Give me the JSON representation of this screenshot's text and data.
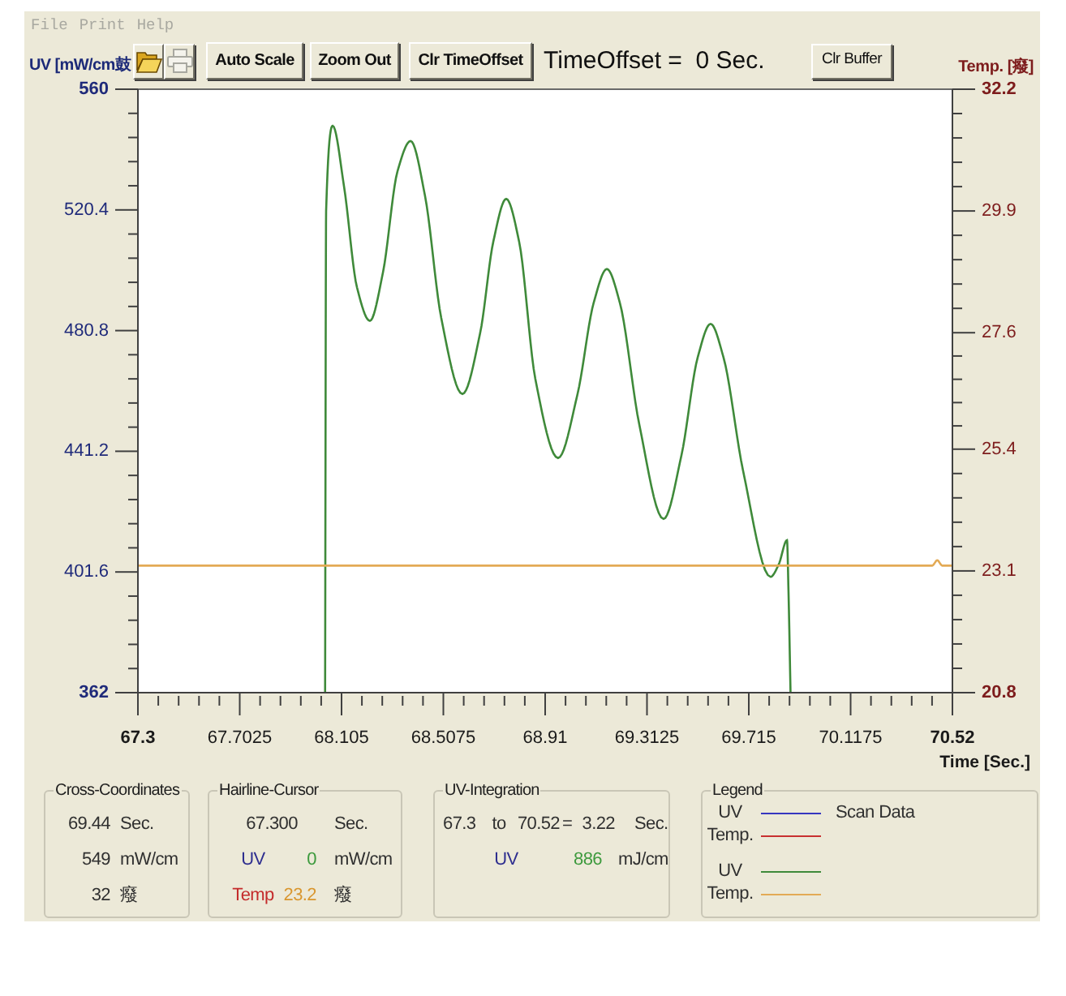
{
  "menu": [
    {
      "label": "File",
      "disabled": true
    },
    {
      "label": "Print",
      "disabled": true
    },
    {
      "label": "Help",
      "disabled": true
    }
  ],
  "toolbar": {
    "icon_buttons": [
      {
        "kind": "folder",
        "disabled": false
      },
      {
        "kind": "printer",
        "disabled": true
      }
    ],
    "buttons": [
      "Auto Scale",
      "Zoom Out",
      "Clr TimeOffset"
    ],
    "offset_text": "TimeOffset =  0 Sec.",
    "clear_button": "Clr Buffer"
  },
  "chart": {
    "chart_data": {
      "type": "line",
      "xlabel": "Time [Sec.]",
      "ylabel": "UV [mW/cm鼓",
      "y2label": "Temp. [癈]",
      "x": [
        67.3,
        68.04,
        68.044,
        68.07,
        68.115,
        68.166,
        68.217,
        68.269,
        68.326,
        68.378,
        68.435,
        68.499,
        68.583,
        68.653,
        68.705,
        68.756,
        68.807,
        68.871,
        68.961,
        69.038,
        69.102,
        69.154,
        69.205,
        69.282,
        69.378,
        69.449,
        69.513,
        69.564,
        69.615,
        69.692,
        69.801,
        69.833,
        69.866,
        69.872,
        69.88,
        70.44,
        70.46,
        70.48,
        70.52
      ],
      "series": [
        {
          "name": "UV",
          "color": "#3f8a3a",
          "values": [
            null,
            362,
            520,
            548,
            528,
            495,
            484,
            500,
            533,
            543,
            525,
            485,
            460,
            480,
            510,
            524,
            510,
            465,
            439,
            460,
            490,
            501,
            490,
            450,
            419,
            440,
            472,
            483,
            472,
            435,
            400,
            404,
            412,
            395,
            362,
            null,
            null,
            null,
            null
          ]
        },
        {
          "name": "Temp.",
          "color": "#e3aa55",
          "axis": "y2",
          "values": [
            23.2,
            23.2,
            23.2,
            23.2,
            23.2,
            23.2,
            23.2,
            23.2,
            23.2,
            23.2,
            23.2,
            23.2,
            23.2,
            23.2,
            23.2,
            23.2,
            23.2,
            23.2,
            23.2,
            23.2,
            23.2,
            23.2,
            23.2,
            23.2,
            23.2,
            23.2,
            23.2,
            23.2,
            23.2,
            23.2,
            23.2,
            23.2,
            23.2,
            23.2,
            23.2,
            23.2,
            23.3,
            23.2,
            23.2
          ]
        }
      ],
      "xlim": [
        67.3,
        70.52
      ],
      "ylim": [
        362,
        560
      ],
      "y2lim": [
        20.8,
        32.2
      ],
      "xticks": [
        67.3,
        67.7025,
        68.105,
        68.5075,
        68.91,
        69.3125,
        69.715,
        70.1175,
        70.52
      ],
      "yticks": [
        560,
        520.4,
        480.8,
        441.2,
        401.6,
        362
      ],
      "y2ticks": [
        32.2,
        29.9,
        27.6,
        25.4,
        23.1,
        20.8
      ]
    }
  },
  "panels": [
    {
      "kind": "readout",
      "title": "Cross-Coordinates",
      "rows": [
        {
          "value": "69.44",
          "unit": "Sec."
        },
        {
          "value": "549",
          "unit": "mW/cm"
        },
        {
          "value": "32",
          "unit": "癈"
        }
      ]
    },
    {
      "kind": "cursor",
      "title": "Hairline-Cursor",
      "rows": [
        {
          "value": {
            "text": "67.300"
          },
          "unit": "Sec."
        },
        {
          "label": {
            "text": "UV",
            "color": "#2e2e8f"
          },
          "value": {
            "text": "0",
            "color": "#3d9a3d"
          },
          "unit": "mW/cm"
        },
        {
          "label": {
            "text": "Temp",
            "color": "#c42b2b"
          },
          "value": {
            "text": "23.2",
            "color": "#d9962e"
          },
          "unit": "癈"
        }
      ]
    },
    {
      "kind": "integration",
      "title": "UV-Integration",
      "rows": [
        {
          "kind": "range",
          "from": "67.3",
          "joiner": "to",
          "to": "70.52",
          "equals": "=",
          "value": "3.22",
          "unit": "Sec."
        },
        {
          "kind": "reading",
          "label": {
            "text": "UV",
            "color": "#2e2e8f"
          },
          "value": {
            "text": "886",
            "color": "#3d9a3d"
          },
          "unit": "mJ/cm"
        }
      ]
    },
    {
      "kind": "legend",
      "title": "Legend",
      "groups": [
        {
          "caption": "Scan Data",
          "items": [
            {
              "label": "UV",
              "color": "#3636c0"
            },
            {
              "label": "Temp.",
              "color": "#c83030"
            }
          ]
        }
      ]
    }
  ]
}
